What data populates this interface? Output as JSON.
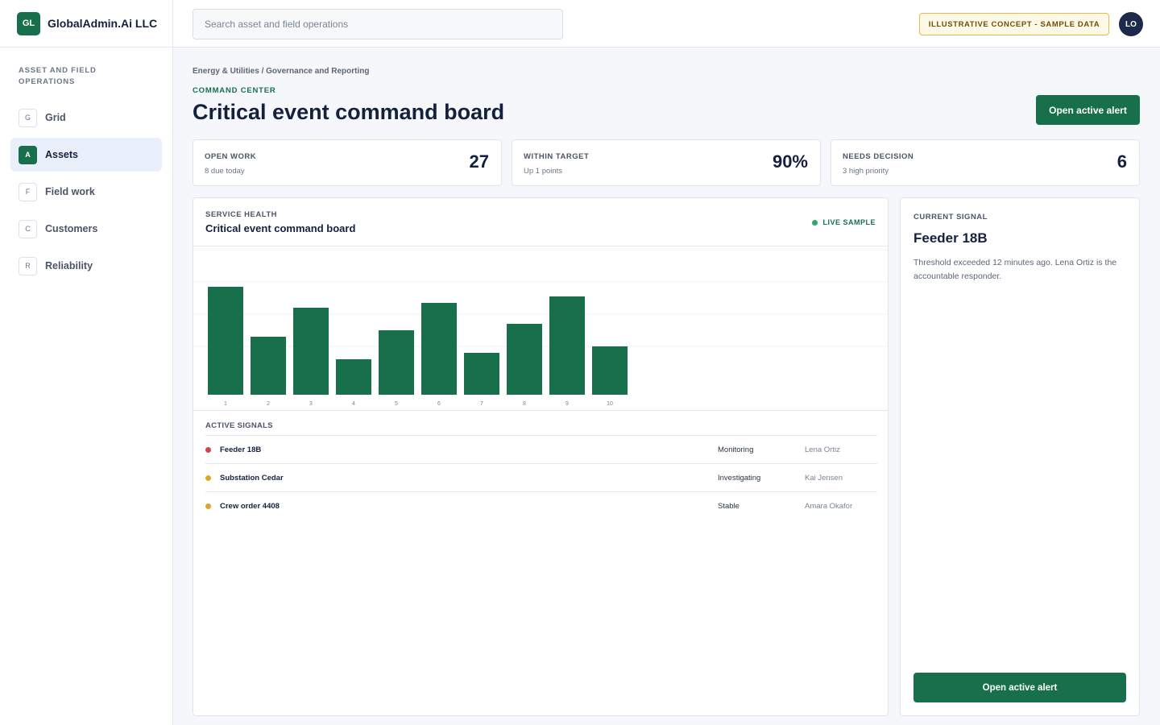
{
  "brand": {
    "logo": "GL",
    "name": "GlobalAdmin.Ai LLC"
  },
  "sidebar": {
    "heading": "ASSET AND FIELD OPERATIONS",
    "items": [
      {
        "badge": "G",
        "label": "Grid",
        "active": false
      },
      {
        "badge": "A",
        "label": "Assets",
        "active": true
      },
      {
        "badge": "F",
        "label": "Field work",
        "active": false
      },
      {
        "badge": "C",
        "label": "Customers",
        "active": false
      },
      {
        "badge": "R",
        "label": "Reliability",
        "active": false
      }
    ]
  },
  "topbar": {
    "search_placeholder": "Search asset and field operations",
    "concept_badge": "ILLUSTRATIVE CONCEPT - SAMPLE DATA",
    "avatar": "LO"
  },
  "header": {
    "breadcrumb": "Energy & Utilities / Governance and Reporting",
    "eyebrow": "COMMAND CENTER",
    "title": "Critical event command board",
    "action_label": "Open active alert"
  },
  "kpis": [
    {
      "label": "OPEN WORK",
      "sub": "8 due today",
      "value": "27"
    },
    {
      "label": "WITHIN TARGET",
      "sub": "Up 1 points",
      "value": "90%"
    },
    {
      "label": "NEEDS DECISION",
      "sub": "3 high priority",
      "value": "6"
    }
  ],
  "service_health": {
    "eyebrow": "SERVICE HEALTH",
    "title": "Critical event command board",
    "live_label": "LIVE SAMPLE"
  },
  "chart_data": {
    "type": "bar",
    "categories": [
      "1",
      "2",
      "3",
      "4",
      "5",
      "6",
      "7",
      "8",
      "9",
      "10"
    ],
    "values": [
      67,
      36,
      54,
      22,
      40,
      57,
      26,
      44,
      61,
      30
    ],
    "ylim": [
      0,
      90
    ],
    "grid": true,
    "color": "#17704b"
  },
  "signals": {
    "title": "ACTIVE SIGNALS",
    "rows": [
      {
        "name": "Feeder 18B",
        "status": "Monitoring",
        "owner": "Lena Ortiz",
        "color": "#d0444b"
      },
      {
        "name": "Substation Cedar",
        "status": "Investigating",
        "owner": "Kai Jensen",
        "color": "#e0a42c"
      },
      {
        "name": "Crew order 4408",
        "status": "Stable",
        "owner": "Amara Okafor",
        "color": "#e0a42c"
      }
    ]
  },
  "current_signal": {
    "eyebrow": "CURRENT SIGNAL",
    "title": "Feeder 18B",
    "description": "Threshold exceeded 12 minutes ago. Lena Ortiz is the accountable responder.",
    "action_label": "Open active alert"
  },
  "colors": {
    "accent": "#17704b",
    "alert": "#d0444b",
    "warning": "#e0a42c",
    "concept_bg": "#fef8e7"
  }
}
